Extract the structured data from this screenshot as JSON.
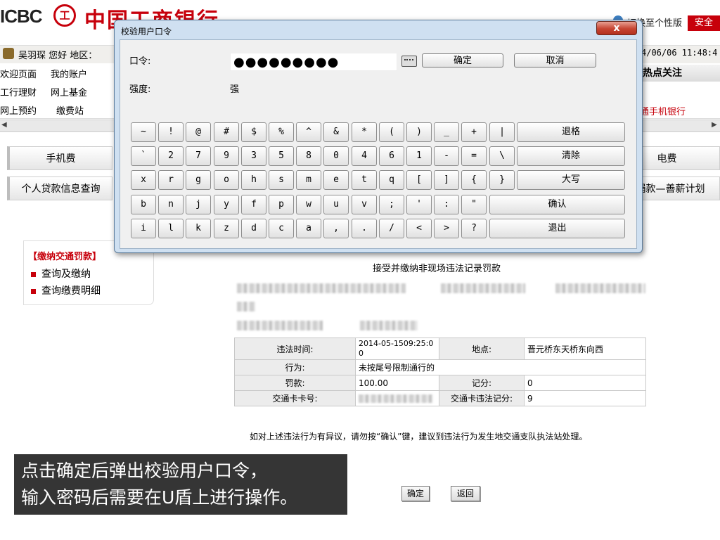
{
  "header": {
    "logo_text": "ICBC",
    "logo_seal": "工",
    "bank_name": "中国工商银行",
    "switch_link": "切换至个性版",
    "safety_button": "安全"
  },
  "userbar": {
    "greeting": "吴羽琛 您好 地区：",
    "datetime": "4/06/06 11:48:4"
  },
  "nav": {
    "row1": [
      "欢迎页面",
      "我的账户"
    ],
    "row2": [
      "工行理财",
      "网上基金"
    ],
    "row3": [
      "网上预约",
      "缴费站"
    ],
    "hot_focus": "热点关注",
    "mobile_bank": "通手机银行"
  },
  "services": {
    "mobile_fee": "手机费",
    "electric": "电费",
    "credit_query": "个人贷款信息查询",
    "donate": "捐款—善薪计划"
  },
  "sidebar": {
    "title": "【缴纳交通罚款】",
    "items": [
      "查询及缴纳",
      "查询缴费明细"
    ]
  },
  "content": {
    "title": "接受并缴纳非现场违法记录罚款",
    "table": {
      "violation_time_label": "违法时间:",
      "violation_time_value": "2014-05-1509:25:00",
      "place_label": "地点:",
      "place_value": "晋元桥东天桥东向西",
      "behavior_label": "行为:",
      "behavior_value": "未按尾号限制通行的",
      "fine_label": "罚款:",
      "fine_value": "100.00",
      "points_label": "记分:",
      "points_value": "0",
      "card_label": "交通卡卡号:",
      "card_points_label": "交通卡违法记分:",
      "card_points_value": "9"
    },
    "dispute_note": "如对上述违法行为有异议，请勿按“确认”键，建议到违法行为发生地交通支队执法站处理。",
    "confirm_button": "确定",
    "back_button": "返回"
  },
  "caption": {
    "line1": "点击确定后弹出校验用户口令，",
    "line2": "输入密码后需要在U盾上进行操作。"
  },
  "dialog": {
    "title": "校验用户口令",
    "close_symbol": "x",
    "password_label": "口令:",
    "password_value": "●●●●●●●●●",
    "ok_button": "确定",
    "cancel_button": "取消",
    "strength_label": "强度:",
    "strength_value": "强",
    "keyboard": {
      "row1": [
        "~",
        "!",
        "@",
        "#",
        "$",
        "%",
        "^",
        "&",
        "*",
        "(",
        ")",
        "_",
        "+",
        "|"
      ],
      "row1_wide": "退格",
      "row2": [
        "`",
        "2",
        "7",
        "9",
        "3",
        "5",
        "8",
        "0",
        "4",
        "6",
        "1",
        "-",
        "=",
        "\\"
      ],
      "row2_wide": "清除",
      "row3": [
        "x",
        "r",
        "g",
        "o",
        "h",
        "s",
        "m",
        "e",
        "t",
        "q",
        "[",
        "]",
        "{",
        "}"
      ],
      "row3_wide": "大写",
      "row4": [
        "b",
        "n",
        "j",
        "y",
        "f",
        "p",
        "w",
        "u",
        "v",
        ";",
        "'",
        ":",
        "\""
      ],
      "row4_wide": "确认",
      "row5": [
        "i",
        "l",
        "k",
        "z",
        "d",
        "c",
        "a",
        ",",
        ".",
        "/",
        "<",
        ">",
        "?"
      ],
      "row5_wide": "退出"
    }
  }
}
